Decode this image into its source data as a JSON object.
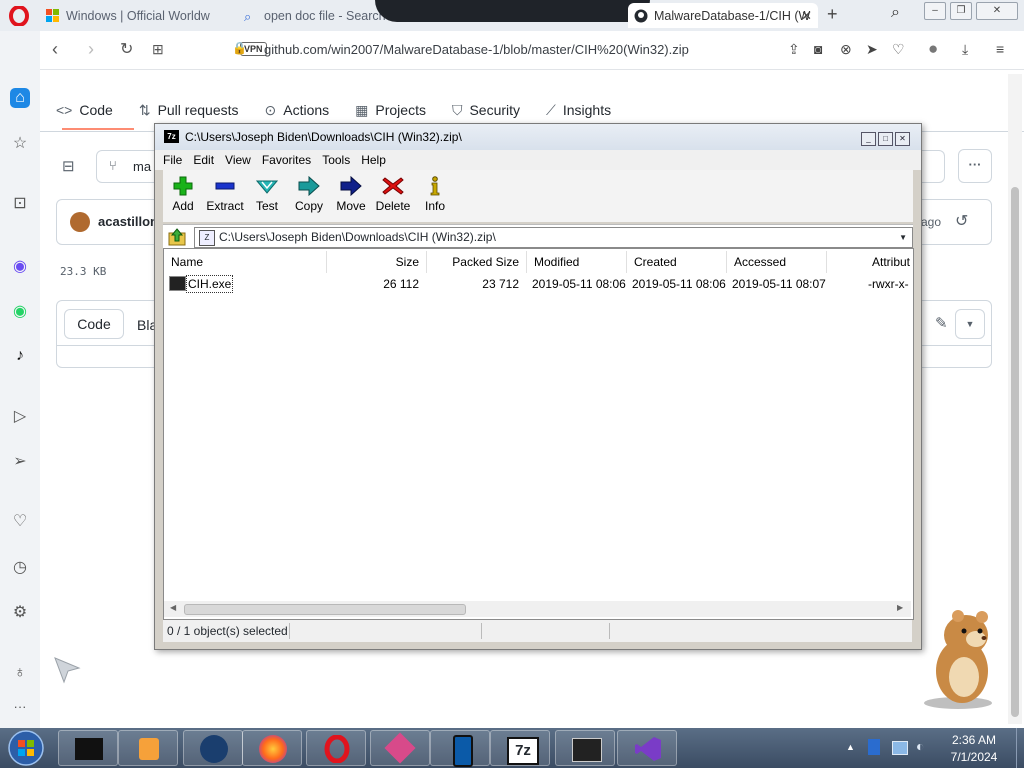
{
  "browser": {
    "tabs": [
      {
        "title": "Windows | Official Worldw",
        "active": false
      },
      {
        "title": "open doc file - Search",
        "active": false
      },
      {
        "title": "MalwareDatabase-1/CIH (W",
        "active": true
      }
    ],
    "new_tab": "+",
    "vpn_label": "VPN",
    "url": "github.com/win2007/MalwareDatabase-1/blob/master/CIH%20(Win32).zip"
  },
  "github": {
    "tabs": [
      {
        "label": "Code",
        "icon": "code-icon"
      },
      {
        "label": "Pull requests",
        "icon": "pull-request-icon"
      },
      {
        "label": "Actions",
        "icon": "play-circle-icon"
      },
      {
        "label": "Projects",
        "icon": "table-icon"
      },
      {
        "label": "Security",
        "icon": "shield-icon"
      },
      {
        "label": "Insights",
        "icon": "graph-icon"
      }
    ],
    "branch_partial": "ma",
    "author_partial": "acastillon",
    "time_partial": "ago",
    "file_size": "23.3 KB",
    "view_code": "Code",
    "view_blame_partial": "Bla"
  },
  "sevenzip": {
    "title": "C:\\Users\\Joseph Biden\\Downloads\\CIH (Win32).zip\\",
    "app_icon": "7z",
    "menu": [
      "File",
      "Edit",
      "View",
      "Favorites",
      "Tools",
      "Help"
    ],
    "toolbar": [
      {
        "label": "Add",
        "icon": "plus-icon",
        "color": "#19b219"
      },
      {
        "label": "Extract",
        "icon": "minus-icon",
        "color": "#1a33cc"
      },
      {
        "label": "Test",
        "icon": "check-icon",
        "color": "#26b5b5"
      },
      {
        "label": "Copy",
        "icon": "copy-arrow-icon",
        "color": "#1a9a9a"
      },
      {
        "label": "Move",
        "icon": "move-arrow-icon",
        "color": "#10208a"
      },
      {
        "label": "Delete",
        "icon": "delete-x-icon",
        "color": "#dd1111"
      },
      {
        "label": "Info",
        "icon": "info-icon",
        "color": "#c8a800"
      }
    ],
    "path": "C:\\Users\\Joseph Biden\\Downloads\\CIH (Win32).zip\\",
    "columns": [
      "Name",
      "Size",
      "Packed Size",
      "Modified",
      "Created",
      "Accessed",
      "Attribut"
    ],
    "files": [
      {
        "name": "CIH.exe",
        "size": "26 112",
        "packed": "23 712",
        "modified": "2019-05-11 08:06",
        "created": "2019-05-11 08:06",
        "accessed": "2019-05-11 08:07",
        "attrib": "-rwxr-x-"
      }
    ],
    "status": "0 / 1 object(s) selected"
  },
  "taskbar": {
    "time": "2:36 AM",
    "date": "7/1/2024",
    "apps": [
      "terminal-app",
      "media-player-app",
      "globe-app",
      "firefox-app",
      "opera-app",
      "tool-app",
      "phone-app",
      "7zip-app",
      "console-app",
      "visual-studio-app"
    ]
  }
}
